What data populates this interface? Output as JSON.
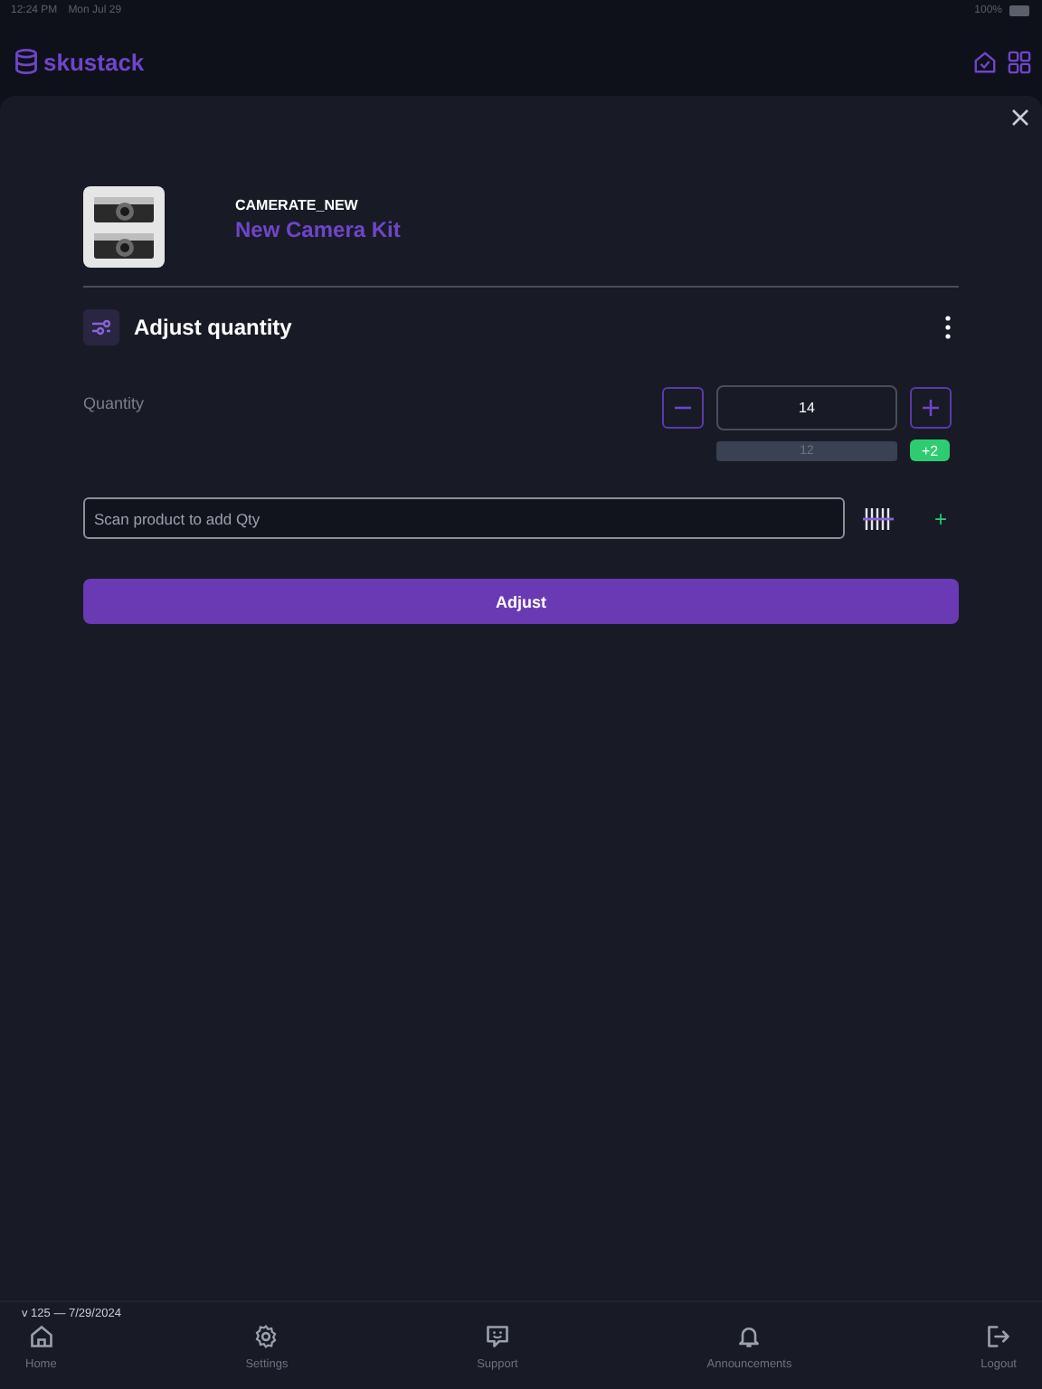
{
  "status_bar": {
    "time": "12:24 PM",
    "date": "Mon Jul 29",
    "battery": "100%"
  },
  "header": {
    "logo": "skustack"
  },
  "product": {
    "sku": "CAMERATE_NEW",
    "name": "New Camera Kit"
  },
  "section": {
    "title": "Adjust quantity"
  },
  "quantity": {
    "label": "Quantity",
    "value": "14",
    "previous": "12",
    "delta": "+2"
  },
  "scan": {
    "placeholder": "Scan product to add Qty",
    "add": "+"
  },
  "adjust_button": "Adjust",
  "version": "v 125 — 7/29/2024",
  "nav": [
    {
      "label": "Home"
    },
    {
      "label": "Settings"
    },
    {
      "label": "Support"
    },
    {
      "label": "Announcements"
    },
    {
      "label": "Logout"
    }
  ]
}
